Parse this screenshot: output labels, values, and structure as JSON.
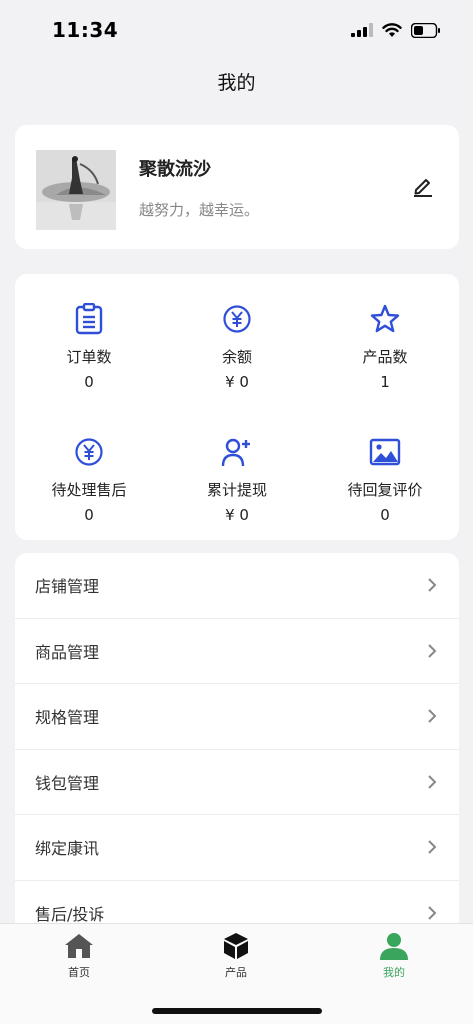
{
  "status_bar": {
    "time": "11:34"
  },
  "nav": {
    "title": "我的"
  },
  "profile": {
    "name": "聚散流沙",
    "motto": "越努力，越幸运。"
  },
  "stats": [
    {
      "label": "订单数",
      "value": "0",
      "icon": "clipboard-icon"
    },
    {
      "label": "余额",
      "value": "¥ 0",
      "icon": "yen-circle-icon"
    },
    {
      "label": "产品数",
      "value": "1",
      "icon": "star-icon"
    },
    {
      "label": "待处理售后",
      "value": "0",
      "icon": "yen-circle-icon"
    },
    {
      "label": "累计提现",
      "value": "¥ 0",
      "icon": "add-user-icon"
    },
    {
      "label": "待回复评价",
      "value": "0",
      "icon": "image-icon"
    }
  ],
  "menu": [
    {
      "label": "店铺管理"
    },
    {
      "label": "商品管理"
    },
    {
      "label": "规格管理"
    },
    {
      "label": "钱包管理"
    },
    {
      "label": "绑定康讯"
    },
    {
      "label": "售后/投诉"
    }
  ],
  "tabs": [
    {
      "label": "首页",
      "icon": "home-icon"
    },
    {
      "label": "产品",
      "icon": "box-icon"
    },
    {
      "label": "我的",
      "icon": "user-icon"
    }
  ],
  "colors": {
    "accent_blue": "#2f4fd8",
    "accent_green": "#3aa55c",
    "background": "#f2f2f4"
  }
}
